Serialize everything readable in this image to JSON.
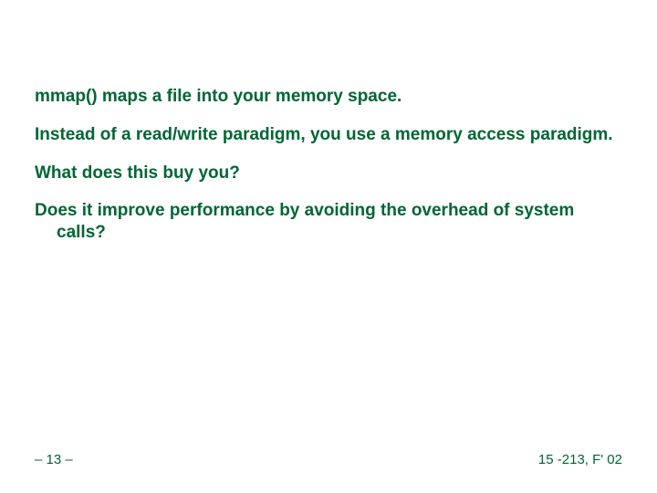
{
  "paragraphs": {
    "p1": "mmap() maps a file into your memory space.",
    "p2": "Instead of a read/write paradigm, you use a memory access paradigm.",
    "p3": "What does this buy you?",
    "p4": "Does it improve performance by avoiding the overhead of system calls?"
  },
  "footer": {
    "page": "– 13 –",
    "course": "15 -213, F' 02"
  }
}
